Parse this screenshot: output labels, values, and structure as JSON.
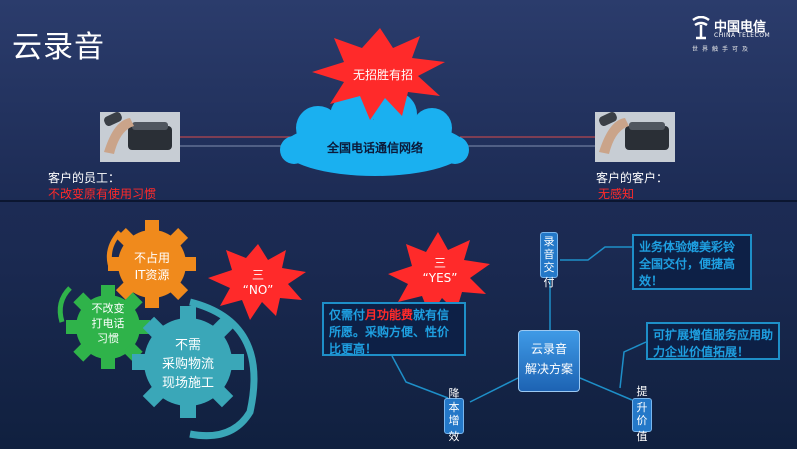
{
  "slide_title": "云录音",
  "logo": {
    "cn": "中国电信",
    "en": "CHINA TELECOM",
    "slogan": "世界触手可及"
  },
  "top": {
    "star_text": "无招胜有招",
    "cloud_text": "全国电话通信网络",
    "left_label": "客户的员工：",
    "left_red": "不改变原有使用习惯",
    "right_label": "客户的客户：",
    "right_red": "无感知"
  },
  "gears": {
    "orange": [
      "不占用",
      "IT资源"
    ],
    "green": [
      "不改变",
      "打电话",
      "习惯"
    ],
    "teal": [
      "不需",
      "采购物流",
      "现场施工"
    ]
  },
  "star_no": {
    "line1": "三",
    "line2": "“NO”"
  },
  "star_yes": {
    "line1": "三",
    "line2": "“YES”"
  },
  "center_box": [
    "云录音",
    "解决方案"
  ],
  "nodes": {
    "top": [
      "录",
      "音",
      "交",
      "付"
    ],
    "left": [
      "降",
      "本",
      "增",
      "效"
    ],
    "right": [
      "提",
      "升",
      "价",
      "值"
    ]
  },
  "callouts": {
    "left_pre": "仅需付",
    "left_red": "月功能费",
    "left_post": "就有信所愿。采购方便、性价比更高！",
    "top": "业务体验媲美彩铃全国交付，便捷高效！",
    "right": "可扩展增值服务应用助力企业价值拓展！"
  },
  "colors": {
    "accent_red": "#ff2a2a",
    "callout_blue": "#1e9fe0",
    "gear_orange": "#f08a1c",
    "gear_green": "#2fb34a",
    "gear_teal": "#3aa7b8"
  }
}
